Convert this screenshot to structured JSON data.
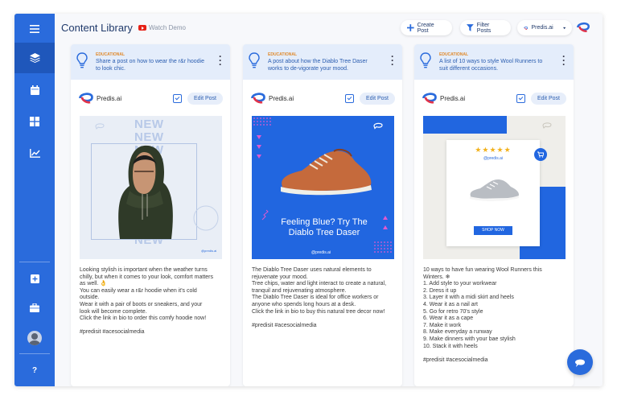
{
  "header": {
    "title": "Content Library",
    "watch_demo": "Watch Demo",
    "create_post": "Create Post",
    "filter_posts": "Filter Posts",
    "brand_select": "Predis.ai"
  },
  "sidebar": {
    "items": [
      {
        "icon": "menu-icon"
      },
      {
        "icon": "layers-icon"
      },
      {
        "icon": "calendar-icon"
      },
      {
        "icon": "grid-icon"
      },
      {
        "icon": "analytics-icon"
      },
      {
        "icon": "add-icon"
      },
      {
        "icon": "briefcase-icon"
      },
      {
        "icon": "avatar"
      },
      {
        "icon": "help-icon",
        "label": "?"
      }
    ]
  },
  "cards": [
    {
      "category": "EDUCATIONAL",
      "prompt": "Share a post on how to wear the r&r hoodie to look chic.",
      "brand": "Predis.ai",
      "edit": "Edit Post",
      "image": {
        "headline": "NEW",
        "tag": "@predis.ai"
      },
      "caption": [
        "Looking stylish is important when the weather turns",
        "chilly, but when it comes to your look, comfort matters",
        "as well. 👌",
        "You can easily wear a r&r hoodie when it's cold",
        "outside.",
        "Wear it with a pair of boots or sneakers, and your",
        "look will become complete.",
        "Click the link in bio to order this comfy hoodie now!",
        "",
        "#predisit #acesocialmedia"
      ]
    },
    {
      "category": "EDUCATIONAL",
      "prompt": "A post about how the Diablo Tree Daser works to de-vigorate your mood.",
      "brand": "Predis.ai",
      "edit": "Edit Post",
      "image": {
        "headline": "Feeling Blue? Try The Diablo Tree Daser",
        "tag": "@predis.ai"
      },
      "caption": [
        "The Diablo Tree Daser uses natural elements to",
        "rejuvenate your mood.",
        "Tree chips, water and light interact to create a natural,",
        "tranquil and rejuvenating atmosphere.",
        "The Diablo Tree Daser is ideal for office workers or",
        "anyone who spends long hours at a desk.",
        "Click the link in bio to buy this natural tree decor now!",
        "",
        "#predisit #acesocialmedia"
      ]
    },
    {
      "category": "EDUCATIONAL",
      "prompt": "A list of 10 ways to style Wool Runners to suit different occasions.",
      "brand": "Predis.ai",
      "edit": "Edit Post",
      "image": {
        "stars": "★★★★★",
        "tag": "@predis.ai",
        "cta": "SHOP NOW"
      },
      "caption": [
        "10 ways to have fun wearing Wool Runners this",
        "Winters. ❄",
        "1. Add style to your workwear",
        "2. Dress it up",
        "3. Layer it with a midi skirt and heels",
        "4. Wear it as a nail art",
        "5. Go for retro 70's style",
        "6. Wear it as a cape",
        "7. Make it work",
        "8. Make everyday a runway",
        "9. Make dinners with your bae stylish",
        "10. Stack it with heels",
        "",
        "#predisit #acesocialmedia"
      ]
    }
  ],
  "colors": {
    "primary": "#2a6bdc",
    "sidebar_active": "#1f57bb",
    "prompt_bg": "#e4edfb",
    "category": "#e08a2c",
    "shoe_post_bg": "#2166e0"
  }
}
